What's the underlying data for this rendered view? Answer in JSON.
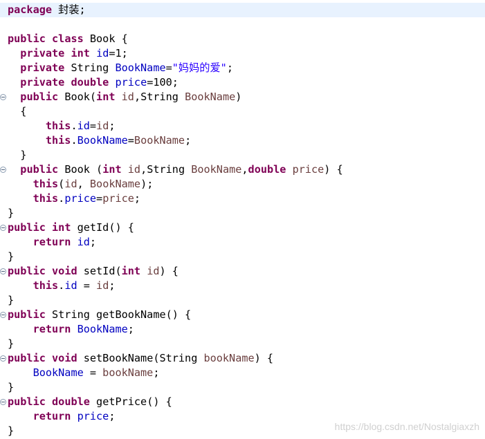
{
  "editor": {
    "lines": [
      [
        {
          "t": "package",
          "c": "kw"
        },
        {
          "t": " 封装;",
          "c": "plain"
        }
      ],
      [],
      [
        {
          "t": "public",
          "c": "kw"
        },
        {
          "t": " ",
          "c": "plain"
        },
        {
          "t": "class",
          "c": "kw"
        },
        {
          "t": " Book {",
          "c": "plain"
        }
      ],
      [
        {
          "t": "  ",
          "c": "plain"
        },
        {
          "t": "private",
          "c": "kw"
        },
        {
          "t": " ",
          "c": "plain"
        },
        {
          "t": "int",
          "c": "kw"
        },
        {
          "t": " ",
          "c": "plain"
        },
        {
          "t": "id",
          "c": "fld"
        },
        {
          "t": "=1;",
          "c": "plain"
        }
      ],
      [
        {
          "t": "  ",
          "c": "plain"
        },
        {
          "t": "private",
          "c": "kw"
        },
        {
          "t": " String ",
          "c": "plain"
        },
        {
          "t": "BookName",
          "c": "fld"
        },
        {
          "t": "=",
          "c": "plain"
        },
        {
          "t": "\"妈妈的爱\"",
          "c": "str"
        },
        {
          "t": ";",
          "c": "plain"
        }
      ],
      [
        {
          "t": "  ",
          "c": "plain"
        },
        {
          "t": "private",
          "c": "kw"
        },
        {
          "t": " ",
          "c": "plain"
        },
        {
          "t": "double",
          "c": "kw"
        },
        {
          "t": " ",
          "c": "plain"
        },
        {
          "t": "price",
          "c": "fld"
        },
        {
          "t": "=100;",
          "c": "plain"
        }
      ],
      [
        {
          "t": "  ",
          "c": "plain"
        },
        {
          "t": "public",
          "c": "kw"
        },
        {
          "t": " Book(",
          "c": "plain"
        },
        {
          "t": "int",
          "c": "kw"
        },
        {
          "t": " ",
          "c": "plain"
        },
        {
          "t": "id",
          "c": "prm"
        },
        {
          "t": ",String ",
          "c": "plain"
        },
        {
          "t": "BookName",
          "c": "prm"
        },
        {
          "t": ")",
          "c": "plain"
        }
      ],
      [
        {
          "t": "  {",
          "c": "plain"
        }
      ],
      [
        {
          "t": "      ",
          "c": "plain"
        },
        {
          "t": "this",
          "c": "kw"
        },
        {
          "t": ".",
          "c": "plain"
        },
        {
          "t": "id",
          "c": "fld"
        },
        {
          "t": "=",
          "c": "plain"
        },
        {
          "t": "id",
          "c": "prm"
        },
        {
          "t": ";",
          "c": "plain"
        }
      ],
      [
        {
          "t": "      ",
          "c": "plain"
        },
        {
          "t": "this",
          "c": "kw"
        },
        {
          "t": ".",
          "c": "plain"
        },
        {
          "t": "BookName",
          "c": "fld"
        },
        {
          "t": "=",
          "c": "plain"
        },
        {
          "t": "BookName",
          "c": "prm"
        },
        {
          "t": ";",
          "c": "plain"
        }
      ],
      [
        {
          "t": "  }",
          "c": "plain"
        }
      ],
      [
        {
          "t": "  ",
          "c": "plain"
        },
        {
          "t": "public",
          "c": "kw"
        },
        {
          "t": " Book (",
          "c": "plain"
        },
        {
          "t": "int",
          "c": "kw"
        },
        {
          "t": " ",
          "c": "plain"
        },
        {
          "t": "id",
          "c": "prm"
        },
        {
          "t": ",String ",
          "c": "plain"
        },
        {
          "t": "BookName",
          "c": "prm"
        },
        {
          "t": ",",
          "c": "plain"
        },
        {
          "t": "double",
          "c": "kw"
        },
        {
          "t": " ",
          "c": "plain"
        },
        {
          "t": "price",
          "c": "prm"
        },
        {
          "t": ") {",
          "c": "plain"
        }
      ],
      [
        {
          "t": "    ",
          "c": "plain"
        },
        {
          "t": "this",
          "c": "kw"
        },
        {
          "t": "(",
          "c": "plain"
        },
        {
          "t": "id",
          "c": "prm"
        },
        {
          "t": ", ",
          "c": "plain"
        },
        {
          "t": "BookName",
          "c": "prm"
        },
        {
          "t": ");",
          "c": "plain"
        }
      ],
      [
        {
          "t": "    ",
          "c": "plain"
        },
        {
          "t": "this",
          "c": "kw"
        },
        {
          "t": ".",
          "c": "plain"
        },
        {
          "t": "price",
          "c": "fld"
        },
        {
          "t": "=",
          "c": "plain"
        },
        {
          "t": "price",
          "c": "prm"
        },
        {
          "t": ";",
          "c": "plain"
        }
      ],
      [
        {
          "t": "}",
          "c": "plain"
        }
      ],
      [
        {
          "t": "public",
          "c": "kw"
        },
        {
          "t": " ",
          "c": "plain"
        },
        {
          "t": "int",
          "c": "kw"
        },
        {
          "t": " getId() {",
          "c": "plain"
        }
      ],
      [
        {
          "t": "    ",
          "c": "plain"
        },
        {
          "t": "return",
          "c": "kw"
        },
        {
          "t": " ",
          "c": "plain"
        },
        {
          "t": "id",
          "c": "fld"
        },
        {
          "t": ";",
          "c": "plain"
        }
      ],
      [
        {
          "t": "}",
          "c": "plain"
        }
      ],
      [
        {
          "t": "public",
          "c": "kw"
        },
        {
          "t": " ",
          "c": "plain"
        },
        {
          "t": "void",
          "c": "kw"
        },
        {
          "t": " setId(",
          "c": "plain"
        },
        {
          "t": "int",
          "c": "kw"
        },
        {
          "t": " ",
          "c": "plain"
        },
        {
          "t": "id",
          "c": "prm"
        },
        {
          "t": ") {",
          "c": "plain"
        }
      ],
      [
        {
          "t": "    ",
          "c": "plain"
        },
        {
          "t": "this",
          "c": "kw"
        },
        {
          "t": ".",
          "c": "plain"
        },
        {
          "t": "id",
          "c": "fld"
        },
        {
          "t": " = ",
          "c": "plain"
        },
        {
          "t": "id",
          "c": "prm"
        },
        {
          "t": ";",
          "c": "plain"
        }
      ],
      [
        {
          "t": "}",
          "c": "plain"
        }
      ],
      [
        {
          "t": "public",
          "c": "kw"
        },
        {
          "t": " String getBookName() {",
          "c": "plain"
        }
      ],
      [
        {
          "t": "    ",
          "c": "plain"
        },
        {
          "t": "return",
          "c": "kw"
        },
        {
          "t": " ",
          "c": "plain"
        },
        {
          "t": "BookName",
          "c": "fld"
        },
        {
          "t": ";",
          "c": "plain"
        }
      ],
      [
        {
          "t": "}",
          "c": "plain"
        }
      ],
      [
        {
          "t": "public",
          "c": "kw"
        },
        {
          "t": " ",
          "c": "plain"
        },
        {
          "t": "void",
          "c": "kw"
        },
        {
          "t": " setBookName(String ",
          "c": "plain"
        },
        {
          "t": "bookName",
          "c": "prm"
        },
        {
          "t": ") {",
          "c": "plain"
        }
      ],
      [
        {
          "t": "    ",
          "c": "plain"
        },
        {
          "t": "BookName",
          "c": "fld"
        },
        {
          "t": " = ",
          "c": "plain"
        },
        {
          "t": "bookName",
          "c": "prm"
        },
        {
          "t": ";",
          "c": "plain"
        }
      ],
      [
        {
          "t": "}",
          "c": "plain"
        }
      ],
      [
        {
          "t": "public",
          "c": "kw"
        },
        {
          "t": " ",
          "c": "plain"
        },
        {
          "t": "double",
          "c": "kw"
        },
        {
          "t": " getPrice() {",
          "c": "plain"
        }
      ],
      [
        {
          "t": "    ",
          "c": "plain"
        },
        {
          "t": "return",
          "c": "kw"
        },
        {
          "t": " ",
          "c": "plain"
        },
        {
          "t": "price",
          "c": "fld"
        },
        {
          "t": ";",
          "c": "plain"
        }
      ],
      [
        {
          "t": "}",
          "c": "plain"
        }
      ]
    ],
    "colors": {
      "keyword": "#7f0055",
      "field": "#0000c0",
      "string": "#2a00ff",
      "parameter": "#6a3e3e",
      "current_line": "#e8f2fe"
    },
    "fold_icon": "fold-collapse-icon"
  },
  "watermark": "https://blog.csdn.net/Nostalgiaxzh"
}
